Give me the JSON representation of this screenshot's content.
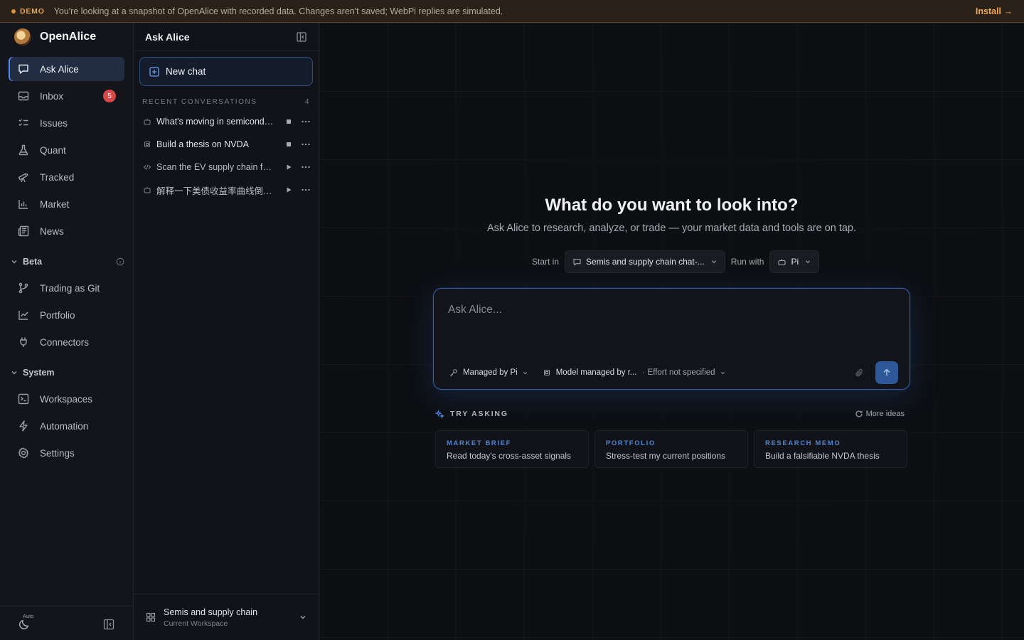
{
  "banner": {
    "tag": "DEMO",
    "message": "You're looking at a snapshot of OpenAlice with recorded data. Changes aren't saved; WebPi replies are simulated.",
    "install": "Install →"
  },
  "app": {
    "name": "OpenAlice"
  },
  "nav": {
    "ask_alice": "Ask Alice",
    "inbox": "Inbox",
    "inbox_badge": "5",
    "issues": "Issues",
    "quant": "Quant",
    "tracked": "Tracked",
    "market": "Market",
    "news": "News",
    "beta_label": "Beta",
    "trading_as_git": "Trading as Git",
    "portfolio": "Portfolio",
    "connectors": "Connectors",
    "system_label": "System",
    "workspaces": "Workspaces",
    "automation": "Automation",
    "settings": "Settings",
    "theme_mode": "Auto"
  },
  "chat_panel": {
    "title": "Ask Alice",
    "new_chat": "New chat",
    "recent_label": "RECENT CONVERSATIONS",
    "recent_count": "4",
    "conversations": [
      {
        "title": "What's moving in semiconductors today?",
        "state": "running"
      },
      {
        "title": "Build a thesis on NVDA",
        "state": "running"
      },
      {
        "title": "Scan the EV supply chain for opportunities",
        "state": "paused"
      },
      {
        "title": "解释一下美债收益率曲线倒挂的含义",
        "state": "paused"
      }
    ],
    "workspace_name": "Semis and supply chain",
    "workspace_sub": "Current Workspace"
  },
  "main": {
    "headline": "What do you want to look into?",
    "subline": "Ask Alice to research, analyze, or trade — your market data and tools are on tap.",
    "start_in_label": "Start in",
    "start_in_value": "Semis and supply chain chat-...",
    "run_with_label": "Run with",
    "run_with_value": "Pi",
    "composer": {
      "placeholder": "Ask Alice...",
      "managed_by": "Managed by Pi",
      "model": "Model managed by r...",
      "effort": "· Effort not specified"
    },
    "try_asking": "TRY ASKING",
    "more_ideas": "More ideas",
    "suggestions": [
      {
        "kicker": "MARKET BRIEF",
        "label": "Read today's cross-asset signals"
      },
      {
        "kicker": "PORTFOLIO",
        "label": "Stress-test my current positions"
      },
      {
        "kicker": "RESEARCH MEMO",
        "label": "Build a falsifiable NVDA thesis"
      }
    ]
  },
  "colors": {
    "accent": "#4d8bf0",
    "banner_bg": "#2a2218",
    "banner_accent": "#eba34e",
    "badge": "#d94848"
  }
}
